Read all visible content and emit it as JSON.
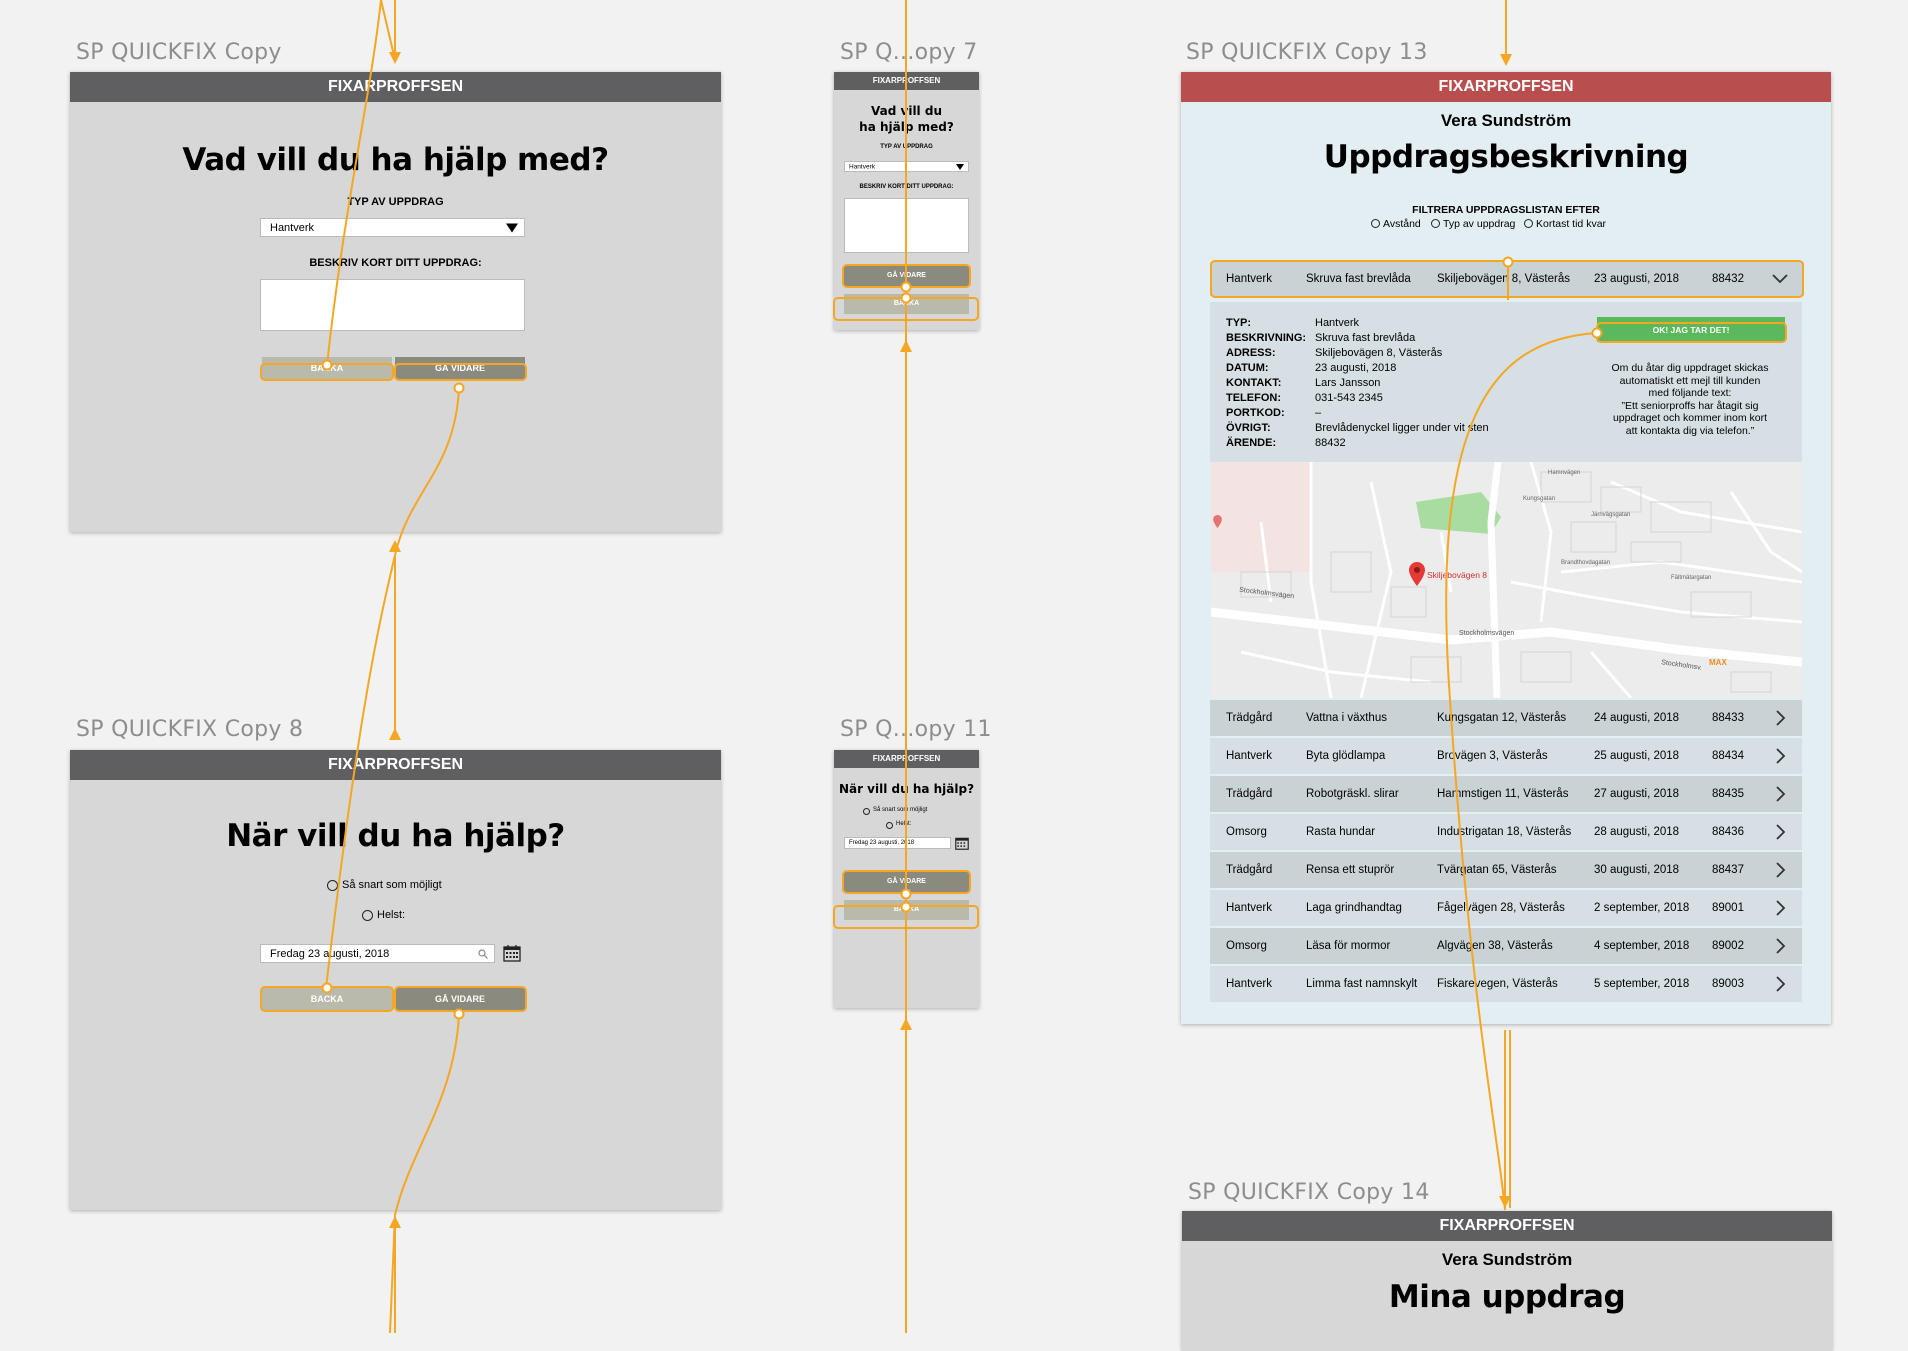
{
  "boards": {
    "b1": "SP QUICKFIX Copy",
    "b2": "SP Q...opy 7",
    "b3": "SP QUICKFIX Copy 13",
    "b4": "SP QUICKFIX Copy 8",
    "b5": "SP Q...opy 11",
    "b6": "SP QUICKFIX Copy 14"
  },
  "app": {
    "brand": "FIXARPROFFSEN"
  },
  "screen_what": {
    "heading": "Vad vill du ha hjälp med?",
    "heading_small_1": "Vad vill du",
    "heading_small_2": "ha hjälp med?",
    "type_label": "TYP AV UPPDRAG",
    "type_value": "Hantverk",
    "describe_label": "BESKRIV KORT DITT UPPDRAG:",
    "back": "BACKA",
    "next": "GÅ VIDARE"
  },
  "screen_when": {
    "heading": "När vill du ha hjälp?",
    "option_asap": "Så snart som möjligt",
    "option_preferred": "Helst:",
    "date_value": "Fredag 23 augusti, 2018",
    "back": "BACKA",
    "next": "GÅ VIDARE"
  },
  "screen_detail": {
    "user": "Vera Sundström",
    "heading": "Uppdragsbeskrivning",
    "filter_label": "FILTRERA UPPDRAGSLISTAN EFTER",
    "filter_options": [
      "Avstånd",
      "Typ av uppdrag",
      "Kortast tid kvar"
    ],
    "selected": {
      "type": "Hantverk",
      "desc": "Skruva fast brevlåda",
      "address": "Skiljebovägen 8, Västerås",
      "date": "23 augusti, 2018",
      "id": "88432"
    },
    "details": [
      {
        "k": "TYP:",
        "v": "Hantverk"
      },
      {
        "k": "BESKRIVNING:",
        "v": "Skruva fast brevlåda"
      },
      {
        "k": "ADRESS:",
        "v": "Skiljebovägen 8, Västerås"
      },
      {
        "k": "DATUM:",
        "v": "23 augusti, 2018"
      },
      {
        "k": "KONTAKT:",
        "v": "Lars Jansson"
      },
      {
        "k": "TELEFON:",
        "v": "031-543 2345"
      },
      {
        "k": "PORTKOD:",
        "v": "–"
      },
      {
        "k": "ÖVRIGT:",
        "v": "Brevlådenyckel ligger under vit sten"
      },
      {
        "k": "ÄRENDE:",
        "v": "88432"
      }
    ],
    "accept_button": "OK! JAG TAR DET!",
    "accept_note_1": "Om du åtar dig uppdraget skickas",
    "accept_note_2": "automatiskt ett mejl till kunden",
    "accept_note_3": "med följande text:",
    "accept_note_4": "”Ett seniorproffs har åtagit sig",
    "accept_note_5": "uppdraget och kommer inom kort",
    "accept_note_6": "att kontakta dig via telefon.”",
    "map": {
      "pin_label": "Skiljebovägen 8",
      "poi": "MAX",
      "streets": [
        "Hamnvägen",
        "Kungsgatan",
        "Stockholmsvägen",
        "Stockholmsvägen",
        "Stockholmsv.",
        "Fältmätargatan",
        "Brandthovdagatan",
        "Järnvägsgatan",
        "Östergatan"
      ]
    },
    "jobs": [
      {
        "type": "Trädgård",
        "desc": "Vattna i växthus",
        "address": "Kungsgatan 12, Västerås",
        "date": "24 augusti, 2018",
        "id": "88433"
      },
      {
        "type": "Hantverk",
        "desc": "Byta glödlampa",
        "address": "Brovägen 3, Västerås",
        "date": "25 augusti, 2018",
        "id": "88434"
      },
      {
        "type": "Trädgård",
        "desc": "Robotgräskl. slirar",
        "address": "Hammstigen 11, Västerås",
        "date": "27 augusti, 2018",
        "id": "88435"
      },
      {
        "type": "Omsorg",
        "desc": "Rasta hundar",
        "address": "Industrigatan 18, Västerås",
        "date": "28 augusti, 2018",
        "id": "88436"
      },
      {
        "type": "Trädgård",
        "desc": "Rensa ett stuprör",
        "address": "Tvärgatan 65, Västerås",
        "date": "30 augusti, 2018",
        "id": "88437"
      },
      {
        "type": "Hantverk",
        "desc": "Laga grindhandtag",
        "address": "Fågelvägen 28, Västerås",
        "date": "2 september, 2018",
        "id": "89001"
      },
      {
        "type": "Omsorg",
        "desc": "Läsa för mormor",
        "address": "Algvägen 38, Västerås",
        "date": "4 september, 2018",
        "id": "89002"
      },
      {
        "type": "Hantverk",
        "desc": "Limma fast namnskylt",
        "address": "Fiskarevegen, Västerås",
        "date": "5 september, 2018",
        "id": "89003"
      }
    ]
  },
  "screen_mine": {
    "user": "Vera Sundström",
    "heading": "Mina uppdrag"
  },
  "colors": {
    "canvas": "#f2f2f2",
    "appbar": "#5f5f62",
    "appbar_alert": "#b94e4e",
    "connector": "#f5a623",
    "accept": "#5cb85c"
  }
}
